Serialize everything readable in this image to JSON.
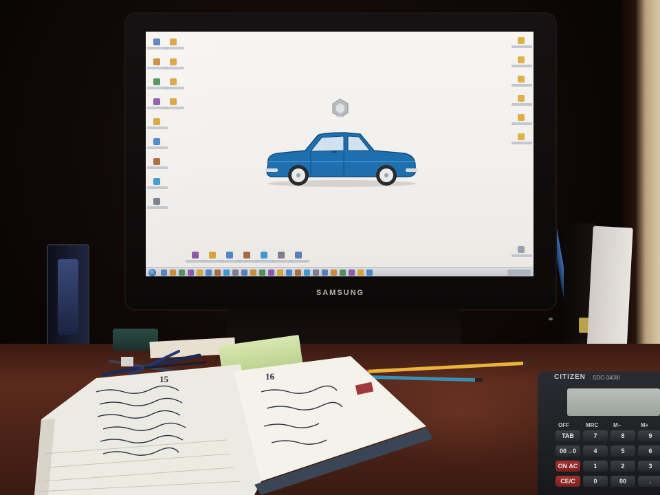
{
  "monitor": {
    "brand": "SAMSUNG"
  },
  "desktop": {
    "left_icons": [
      "computer-icon",
      "recycle-bin-icon",
      "network-icon",
      "control-panel-icon",
      "folder-icon",
      "document-icon",
      "settings-icon",
      "browser-icon",
      "app-icon"
    ],
    "right_icons": [
      "folder-icon",
      "folder-icon",
      "folder-icon",
      "folder-icon",
      "folder-icon",
      "folder-icon",
      "recycle-bin-icon"
    ],
    "bottom_icons": [
      "app-icon",
      "app-icon",
      "app-icon",
      "app-icon",
      "app-icon",
      "app-icon",
      "app-icon"
    ],
    "wallpaper": "blue-car-wallpaper"
  },
  "diary": {
    "left_page_number": "15",
    "right_page_number": "16"
  },
  "calculator": {
    "brand": "CITIZEN",
    "model": "SDC-340III",
    "row1_labels": [
      "OFF",
      "MRC",
      "M−",
      "M+"
    ],
    "row2_labels": [
      "TAB",
      "7",
      "8",
      "9"
    ],
    "row3_labels": [
      "00→0",
      "4",
      "5",
      "6"
    ],
    "row4_labels": [
      "ON AC",
      "1",
      "2",
      "3"
    ],
    "row5_labels": [
      "CE/C",
      "0",
      "00",
      "."
    ]
  },
  "colors": {
    "car": "#1e6fae",
    "wallpaper": "#f3f1ee",
    "desk": "#4c2318"
  }
}
